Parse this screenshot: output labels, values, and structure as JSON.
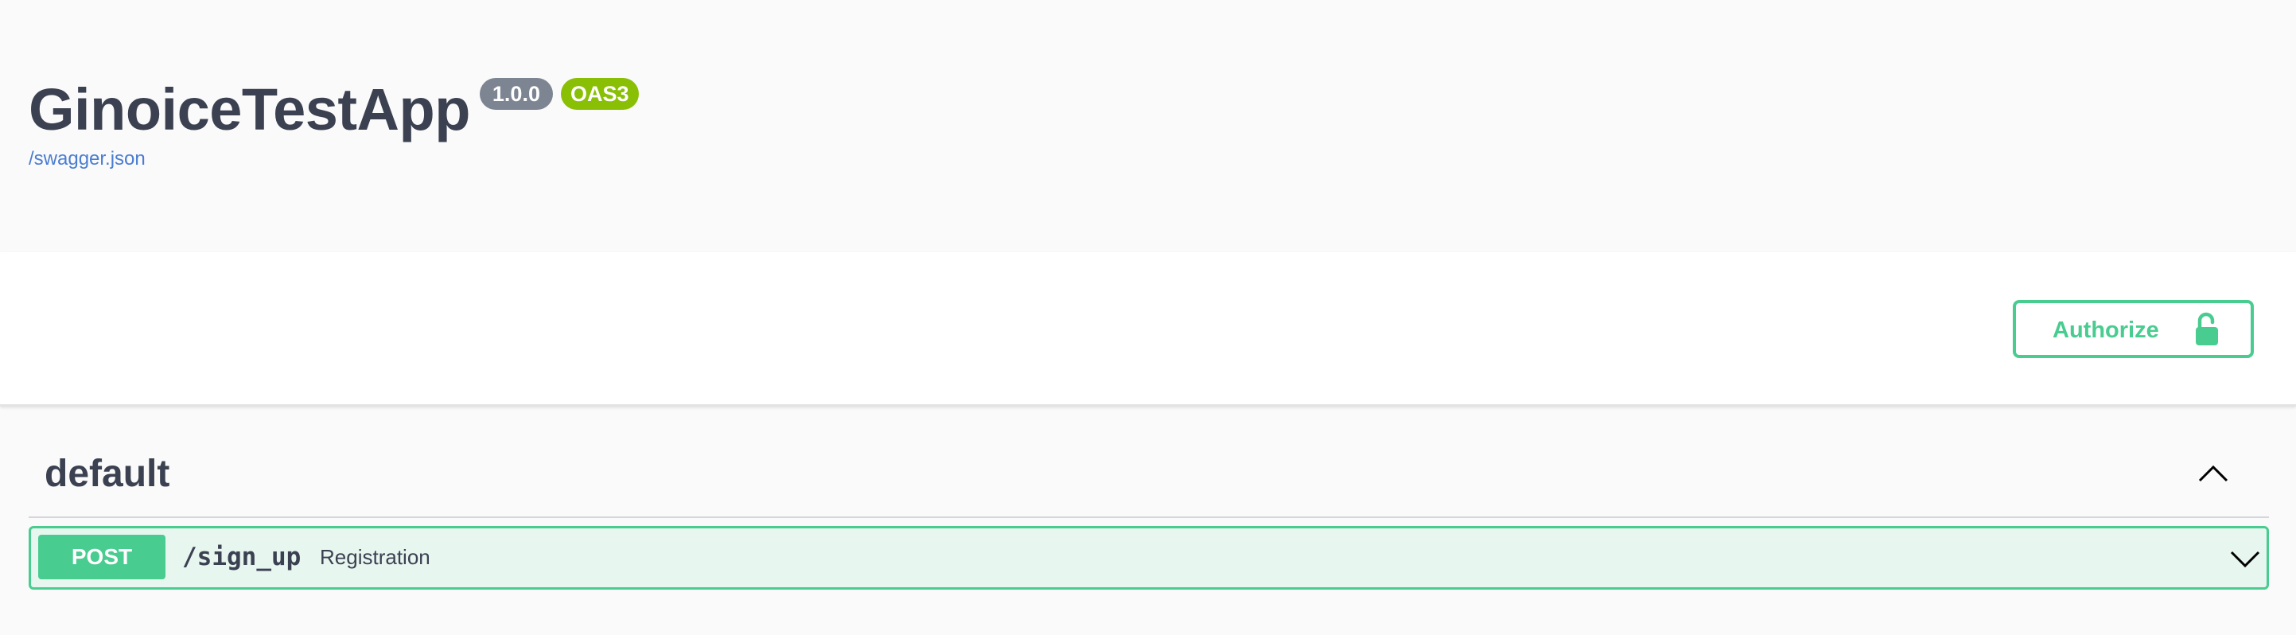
{
  "info": {
    "title": "GinoiceTestApp",
    "version": "1.0.0",
    "oas_badge": "OAS3",
    "spec_url": "/swagger.json"
  },
  "scheme": {
    "authorize_label": "Authorize",
    "authorize_icon": "unlocked-padlock-icon"
  },
  "tag": {
    "name": "default",
    "toggle_icon": "chevron-up-icon"
  },
  "operations": [
    {
      "method": "POST",
      "path": "/sign_up",
      "summary": "Registration",
      "toggle_icon": "chevron-down-icon"
    }
  ],
  "colors": {
    "post": "#49cc90",
    "post_bg": "#e8f6f0",
    "version_badge": "#7d8492",
    "oas_badge": "#89bf04",
    "link": "#4a7dd1",
    "text": "#3b4151"
  }
}
